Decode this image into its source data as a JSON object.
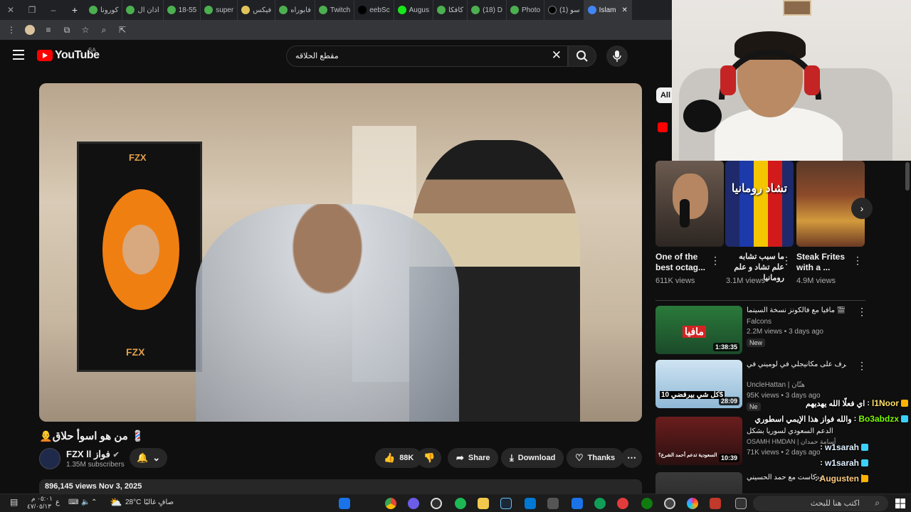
{
  "browser": {
    "tabs": [
      {
        "label": "Islam",
        "active": false,
        "color": "#4285f4"
      },
      {
        "label": "(1) سو",
        "active": false,
        "color": "#000000"
      },
      {
        "label": "Photo",
        "active": false,
        "color": "#4caf50"
      },
      {
        "label": "(18) D",
        "active": false,
        "color": "#4caf50"
      },
      {
        "label": "كافكا",
        "active": false,
        "color": "#4caf50"
      },
      {
        "label": "Augus",
        "active": false,
        "color": "#19e619"
      },
      {
        "label": "eebSc",
        "active": false,
        "color": "#000000"
      },
      {
        "label": "Twitch",
        "active": false,
        "color": "#4caf50"
      },
      {
        "label": "فابوراه",
        "active": false,
        "color": "#4caf50"
      },
      {
        "label": "فيكس",
        "active": false,
        "color": "#e0c45b"
      },
      {
        "label": "super",
        "active": false,
        "color": "#4caf50"
      },
      {
        "label": "18-55",
        "active": false,
        "color": "#4caf50"
      },
      {
        "label": "اذان ال",
        "active": false,
        "color": "#4caf50"
      },
      {
        "label": "كورونا",
        "active": false,
        "color": "#4caf50"
      }
    ]
  },
  "youtube": {
    "logo_text": "YouTube",
    "region": "SA",
    "search_query": "مقطع الحلاقه",
    "video": {
      "title": "🧑‍🦲من هو اسوأ حلاق 💈",
      "channel": "FZX ll فواز",
      "subscribers": "1.35M subscribers",
      "likes": "88K",
      "share_label": "Share",
      "download_label": "Download",
      "thanks_label": "Thanks",
      "views_date": "896,145 views  Nov 3, 2025",
      "frame_card_text": "FZX"
    },
    "filter_chip": "All",
    "shorts": [
      {
        "title": "One of the best octag...",
        "views": "611K views",
        "overlay": ""
      },
      {
        "title": "ما سبب تشابه علم تشاد و علم رومانيا",
        "views": "3.1M views",
        "overlay": "تشاد رومانيا"
      },
      {
        "title": "Steak Frites with a ...",
        "views": "4.9M views",
        "overlay": ""
      }
    ],
    "recommended": [
      {
        "title": "مافيا مع فالكونز نسخة السينما 🎬 🔥",
        "channel": "Falcons",
        "meta": "2.2M views • 3 days ago",
        "badge": "New",
        "duration": "1:38:35",
        "thumb_text": "مافيا"
      },
      {
        "title": "اسرف على مكانيجلي في لوميني في 😂",
        "channel": "UncleHattan | هتّان",
        "meta": "95K views • 3 days ago",
        "badge": "Ne",
        "duration": "28:09",
        "thumb_text": "كل شي بيرفضي 10$"
      },
      {
        "title": "الدعم السعودي لسوريا بشكل",
        "channel": "OSAMH HMDAN | أسامة حمدان",
        "meta": "71K views • 2 days ago",
        "badge": "",
        "duration": "10:39",
        "thumb_text": "السعودية تدعم أحمد الشرع؟"
      },
      {
        "title": "بودكاست مع حمد الحسيني",
        "channel": "",
        "meta": "",
        "badge": "",
        "duration": "",
        "thumb_text": ""
      }
    ]
  },
  "chat": [
    {
      "user": "l1Noor",
      "message": "اي فعلًا الله يهديهم"
    },
    {
      "user": "Bo3abdzx",
      "message": "والله فواز هذا الإيمي اسطوري"
    },
    {
      "user": "w1sarah",
      "message": ""
    },
    {
      "user": "w1sarah",
      "message": ""
    },
    {
      "user": "Augusten",
      "message": ""
    }
  ],
  "taskbar": {
    "weather_temp": "28°C",
    "weather_text": "صافٍ غالبًا",
    "time": "٠٥:٠١ م",
    "date": "٤٧/٠٥/١٣",
    "search_placeholder": "اكتب هنا للبحث",
    "lang": "ع"
  }
}
